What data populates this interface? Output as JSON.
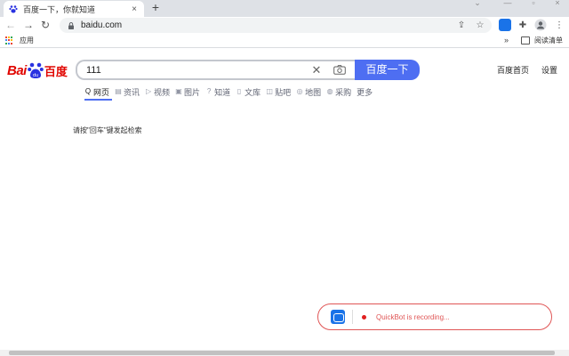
{
  "browser": {
    "tab_title": "百度一下，你就知道",
    "tab_close": "×",
    "new_tab": "+",
    "url": "baidu.com",
    "bookmarks_apps_label": "应用",
    "bookmarks_more": "»",
    "reading_list_label": "阅读清单"
  },
  "baidu": {
    "logo_bai": "Bai",
    "logo_baidu": "百度",
    "search_query": "111",
    "search_button": "百度一下",
    "home_link": "百度首页",
    "settings_link": "设置",
    "tabs": [
      {
        "icon": "Q",
        "label": "网页",
        "name": "search-icon",
        "active": true
      },
      {
        "icon": "▤",
        "label": "资讯",
        "name": "news-icon"
      },
      {
        "icon": "▷",
        "label": "视频",
        "name": "video-icon"
      },
      {
        "icon": "▣",
        "label": "图片",
        "name": "image-icon"
      },
      {
        "icon": "?",
        "label": "知道",
        "name": "question-icon"
      },
      {
        "icon": "▯",
        "label": "文库",
        "name": "document-icon"
      },
      {
        "icon": "◫",
        "label": "贴吧",
        "name": "forum-icon"
      },
      {
        "icon": "◎",
        "label": "地图",
        "name": "map-icon"
      },
      {
        "icon": "◍",
        "label": "采购",
        "name": "purchase-icon"
      },
      {
        "label": "更多"
      }
    ],
    "hint": "请按\"回车\"键发起检索"
  },
  "recorder": {
    "status_text": "QuickBot is recording..."
  },
  "colors": {
    "accent_blue": "#4e6ef2",
    "baidu_red": "#e10601",
    "recording_red": "#e05656"
  }
}
